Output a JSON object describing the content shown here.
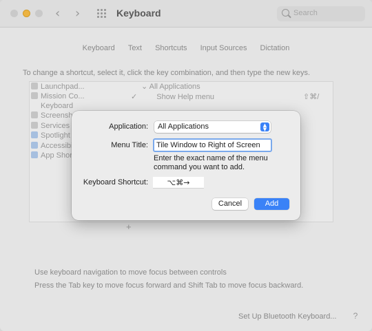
{
  "window": {
    "title": "Keyboard",
    "search_placeholder": "Search"
  },
  "tabs": [
    "Keyboard",
    "Text",
    "Shortcuts",
    "Input Sources",
    "Dictation"
  ],
  "instruction": "To change a shortcut, select it, click the key combination, and then type the new keys.",
  "sidebar": {
    "items": [
      {
        "label": "Launchpad...",
        "icon": "launchpad-icon"
      },
      {
        "label": "Mission Co...",
        "icon": "mission-control-icon"
      },
      {
        "label": "Keyboard",
        "icon": "keyboard-icon"
      },
      {
        "label": "Screensh...",
        "icon": "screenshot-icon"
      },
      {
        "label": "Services",
        "icon": "services-icon"
      },
      {
        "label": "Spotlight",
        "icon": "spotlight-icon"
      },
      {
        "label": "Accessibi...",
        "icon": "accessibility-icon"
      },
      {
        "label": "App Short...",
        "icon": "app-shortcuts-icon"
      }
    ]
  },
  "tree": {
    "group_label": "All Applications",
    "item_label": "Show Help menu",
    "item_shortcut": "⇧⌘/"
  },
  "add_button": "+",
  "footer": {
    "keyboard_nav": "Use keyboard navigation to move focus between controls",
    "keyboard_nav_hint": "Press the Tab key to move focus forward and Shift Tab to move focus backward.",
    "bluetooth_button": "Set Up Bluetooth Keyboard...",
    "help": "?"
  },
  "dialog": {
    "application_label": "Application:",
    "application_value": "All Applications",
    "menu_title_label": "Menu Title:",
    "menu_title_value": "Tile Window to Right of Screen",
    "hint": "Enter the exact name of the menu command you want to add.",
    "shortcut_label": "Keyboard Shortcut:",
    "shortcut_value": "⌥⌘→",
    "cancel_label": "Cancel",
    "add_label": "Add"
  },
  "colors": {
    "accent": "#3a82f7",
    "focus_ring": "#7aa9ec",
    "minimize": "#f5b73b"
  }
}
